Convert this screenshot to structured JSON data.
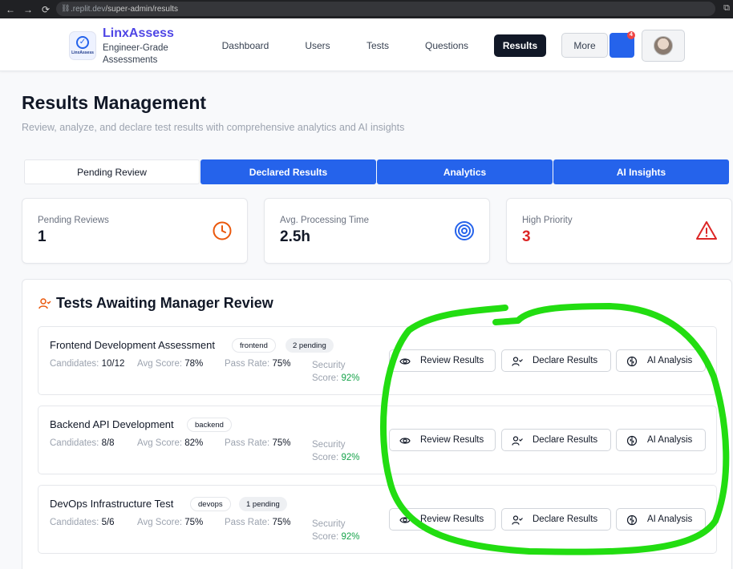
{
  "browser": {
    "url_host": ".replit.dev",
    "url_path": "/super-admin/results"
  },
  "header": {
    "brand_name": "LinxAssess",
    "brand_tagline": "Engineer-Grade Assessments",
    "logo_text": "LinxAssess",
    "nav": [
      "Dashboard",
      "Users",
      "Tests",
      "Questions",
      "Results"
    ],
    "active_nav": "Results",
    "more_label": "More",
    "notification_count": "4"
  },
  "page": {
    "title": "Results Management",
    "subtitle": "Review, analyze, and declare test results with comprehensive analytics and AI insights"
  },
  "tabs": [
    "Pending Review",
    "Declared Results",
    "Analytics",
    "AI Insights"
  ],
  "stats": [
    {
      "label": "Pending Reviews",
      "value": "1",
      "icon": "clock-icon",
      "color": "#ea580c"
    },
    {
      "label": "Avg. Processing Time",
      "value": "2.5h",
      "icon": "target-icon",
      "color": "#2563eb"
    },
    {
      "label": "High Priority",
      "value": "3",
      "icon": "warning-icon",
      "color": "#dc2626"
    }
  ],
  "section": {
    "title": "Tests Awaiting Manager Review",
    "candidates_label": "Candidates:",
    "avg_score_label": "Avg Score:",
    "pass_rate_label": "Pass Rate:",
    "security_label_1": "Security",
    "security_label_2": "Score:",
    "buttons": {
      "review": "Review Results",
      "declare": "Declare Results",
      "ai": "AI Analysis"
    }
  },
  "tests": [
    {
      "title": "Frontend Development Assessment",
      "category": "frontend",
      "pending": "2 pending",
      "candidates": "10/12",
      "avg_score": "78%",
      "pass_rate": "75%",
      "security_score": "92%"
    },
    {
      "title": "Backend API Development",
      "category": "backend",
      "pending": "",
      "candidates": "8/8",
      "avg_score": "82%",
      "pass_rate": "75%",
      "security_score": "92%"
    },
    {
      "title": "DevOps Infrastructure Test",
      "category": "devops",
      "pending": "1 pending",
      "candidates": "5/6",
      "avg_score": "75%",
      "pass_rate": "75%",
      "security_score": "92%"
    }
  ],
  "colors": {
    "primary": "#2563eb",
    "annotation": "#22dd11"
  }
}
